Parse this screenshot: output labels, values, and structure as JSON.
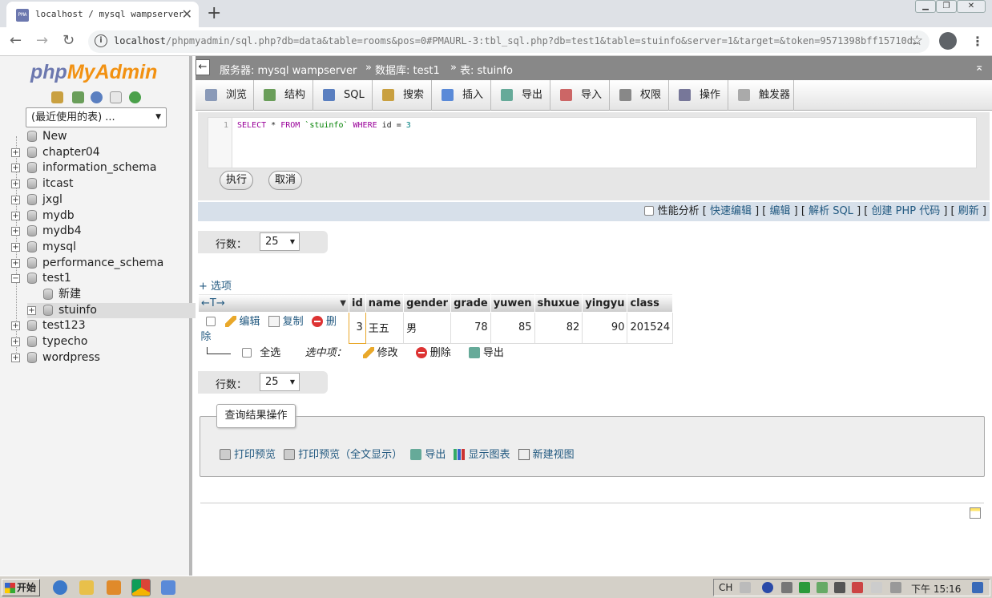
{
  "browser": {
    "tab_title": "localhost / mysql wampserver",
    "url_host": "localhost",
    "url_rest": "/phpmyadmin/sql.php?db=data&table=rooms&pos=0#PMAURL-3:tbl_sql.php?db=test1&table=stuinfo&server=1&target=&token=9571398bff15710d…",
    "favicon_text": "PMA"
  },
  "sidebar": {
    "logo_php": "php",
    "logo_my": "My",
    "logo_admin": "Admin",
    "recent_tables": "(最近使用的表) ...",
    "tree": [
      {
        "label": "New",
        "level": 0,
        "expander": ""
      },
      {
        "label": "chapter04",
        "level": 0,
        "expander": "+"
      },
      {
        "label": "information_schema",
        "level": 0,
        "expander": "+"
      },
      {
        "label": "itcast",
        "level": 0,
        "expander": "+"
      },
      {
        "label": "jxgl",
        "level": 0,
        "expander": "+"
      },
      {
        "label": "mydb",
        "level": 0,
        "expander": "+"
      },
      {
        "label": "mydb4",
        "level": 0,
        "expander": "+"
      },
      {
        "label": "mysql",
        "level": 0,
        "expander": "+"
      },
      {
        "label": "performance_schema",
        "level": 0,
        "expander": "+"
      },
      {
        "label": "test1",
        "level": 0,
        "expander": "−"
      },
      {
        "label": "新建",
        "level": 1,
        "expander": ""
      },
      {
        "label": "stuinfo",
        "level": 1,
        "expander": "+"
      },
      {
        "label": "test123",
        "level": 0,
        "expander": "+"
      },
      {
        "label": "typecho",
        "level": 0,
        "expander": "+"
      },
      {
        "label": "wordpress",
        "level": 0,
        "expander": "+"
      }
    ]
  },
  "breadcrumb": {
    "server": "服务器: mysql wampserver",
    "database": "数据库: test1",
    "table": "表: stuinfo"
  },
  "menu": [
    "浏览",
    "结构",
    "SQL",
    "搜索",
    "插入",
    "导出",
    "导入",
    "权限",
    "操作",
    "触发器"
  ],
  "sql": {
    "line_no": "1",
    "kw_select": "SELECT",
    "star": " * ",
    "kw_from": "FROM",
    "table": " `stuinfo` ",
    "kw_where": "WHERE",
    "cond": " id = ",
    "value": "3",
    "execute_label": "执行",
    "cancel_label": "取消"
  },
  "profiling": {
    "label": "性能分析",
    "links": [
      "快速编辑",
      "编辑",
      "解析 SQL",
      "创建 PHP 代码",
      "刷新"
    ]
  },
  "rows": {
    "label": "行数：",
    "value": "25"
  },
  "options_link": "+ 选项",
  "nav_arrows": "←T→",
  "table": {
    "columns": [
      "id",
      "name",
      "gender",
      "grade",
      "yuwen",
      "shuxue",
      "yingyu",
      "class"
    ],
    "rows": [
      {
        "id": "3",
        "name": "王五",
        "gender": "男",
        "grade": "78",
        "yuwen": "85",
        "shuxue": "82",
        "yingyu": "90",
        "class": "201524"
      }
    ],
    "row_actions": {
      "edit": "编辑",
      "copy": "复制",
      "delete": "删除"
    }
  },
  "with_selected": {
    "check_all": "全选",
    "label": "选中项：",
    "modify": "修改",
    "delete": "删除",
    "export": "导出"
  },
  "query_ops": {
    "legend": "查询结果操作",
    "items": [
      "打印预览",
      "打印预览（全文显示）",
      "导出",
      "显示图表",
      "新建视图"
    ]
  },
  "taskbar": {
    "start": "开始",
    "lang": "CH",
    "clock": "下午 15:16"
  }
}
